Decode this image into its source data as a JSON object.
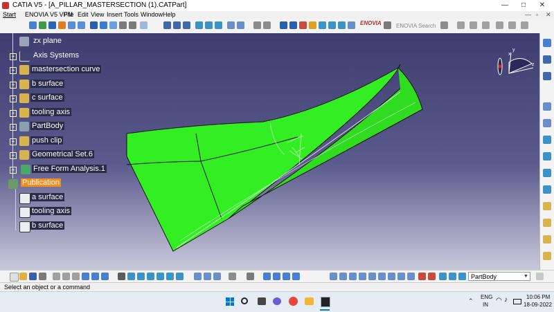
{
  "window": {
    "title": "CATIA V5 - [A_PILLAR_MASTERSECTION (1).CATPart]",
    "minimize": "—",
    "maximize": "□",
    "close": "✕"
  },
  "menu": [
    "Start",
    "ENOVIA V5 VPM",
    "File",
    "Edit",
    "View",
    "Insert",
    "Tools",
    "Window",
    "Help"
  ],
  "toolbar": {
    "enovia_label": "ENOVIA",
    "enovia_search": "ENOVIA Search"
  },
  "tree": {
    "items": [
      {
        "label": "zx plane",
        "icon": "plane-icon"
      },
      {
        "label": "Axis Systems",
        "icon": "axis-icon"
      },
      {
        "label": "mastersection curve",
        "icon": "geometrical-set-icon"
      },
      {
        "label": "b surface",
        "icon": "geometrical-set-icon"
      },
      {
        "label": "c surface",
        "icon": "geometrical-set-icon"
      },
      {
        "label": "tooling axis",
        "icon": "geometrical-set-icon"
      },
      {
        "label": "PartBody",
        "icon": "partbody-icon"
      },
      {
        "label": "push clip",
        "icon": "geometrical-set-icon"
      },
      {
        "label": "Geometrical Set.6",
        "icon": "geometrical-set-icon"
      },
      {
        "label": "Free Form Analysis.1",
        "icon": "analysis-icon"
      },
      {
        "label": "Publication",
        "icon": "publication-icon",
        "selected": true
      },
      {
        "label": "a surface",
        "icon": "publication-item-icon"
      },
      {
        "label": "tooling axis",
        "icon": "publication-item-icon"
      },
      {
        "label": "b surface",
        "icon": "publication-item-icon"
      }
    ]
  },
  "compass": {
    "x": "x",
    "y": "y",
    "z": "z"
  },
  "bottom_toolbar": {
    "current_body": "PartBody"
  },
  "status_bar": {
    "message": "Select an object or a command"
  },
  "taskbar": {
    "lang1": "ENG",
    "lang2": "IN",
    "time": "10:06 PM",
    "date": "18-09-2022"
  },
  "colors": {
    "surface": "#33ee22",
    "viewport_top": "#3d3d70",
    "selection": "#f28c1e"
  }
}
